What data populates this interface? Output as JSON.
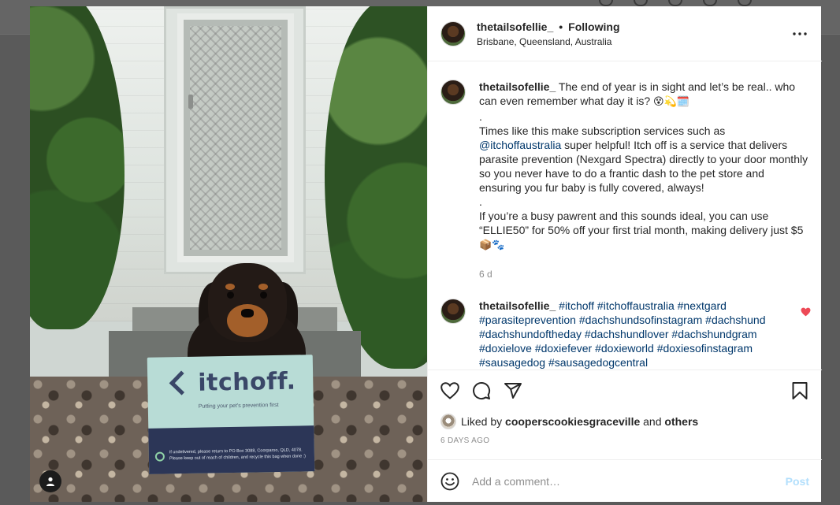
{
  "post": {
    "username": "thetailsofellie_",
    "separator": "•",
    "follow_status": "Following",
    "location": "Brisbane, Queensland, Australia"
  },
  "photo": {
    "bag_brand": "itchoff.",
    "bag_tagline": "Putting your pet's prevention first",
    "bag_fineprint": "If undelivered, please return to PO Box 3088, Coorparoo, QLD, 4078. Please keep out of reach of children, and recycle this bag when done :)"
  },
  "caption": {
    "username": "thetailsofellie_",
    "line1": "The end of year is in sight and let’s be real.. who can even remember what day it is? ",
    "line1_emoji": "😵💫🗓️",
    "dot1": ".",
    "line2_pre": "Times like this make subscription services such as ",
    "mention": "@itchoffaustralia",
    "line2_post": " super helpful! Itch off is a service that delivers parasite prevention (Nexgard Spectra) directly to your door monthly so you never have to do a frantic dash to the pet store and ensuring you fur baby is fully covered, always!",
    "dot2": ".",
    "line3": "If you’re a busy pawrent and this sounds ideal, you can use “ELLIE50” for 50% off your first trial month, making delivery just $5 ",
    "line3_emoji": "📦🐾",
    "time": "6 d"
  },
  "hashtag_comment": {
    "username": "thetailsofellie_",
    "tags": "#itchoff #itchoffaustralia #nextgard #parasiteprevention #dachshundsofinstagram #dachshund #dachshundoftheday #dachshundlover #dachshundgram #doxielove #doxiefever #doxieworld #doxiesofinstagram #sausagedog #sausagedogcentral",
    "like_icon_color": "#ed4956"
  },
  "actions": {
    "icons": [
      "heart-icon",
      "comment-icon",
      "share-icon",
      "bookmark-icon"
    ]
  },
  "likes": {
    "prefix": "Liked by",
    "liker": "cooperscookiesgraceville",
    "and": "and",
    "others": "others"
  },
  "timestamp": "6 DAYS AGO",
  "comment_box": {
    "placeholder": "Add a comment…",
    "post_label": "Post"
  },
  "colors": {
    "link": "#00376b",
    "post_disabled": "#b2dffc",
    "muted": "#8e8e8e"
  }
}
